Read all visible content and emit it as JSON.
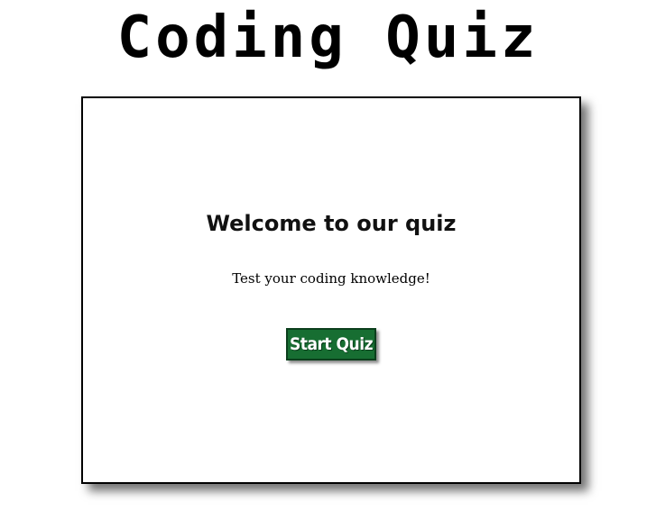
{
  "header": {
    "title": "Coding Quiz"
  },
  "card": {
    "heading": "Welcome to our quiz",
    "tagline": "Test your coding knowledge!",
    "start_button_label": "Start Quiz"
  },
  "colors": {
    "button_background": "#176e32",
    "button_text": "#ffffff",
    "card_border": "#000000",
    "page_background": "#ffffff"
  }
}
